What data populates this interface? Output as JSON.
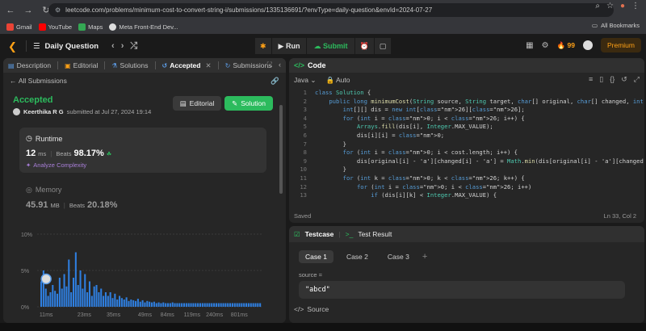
{
  "browser": {
    "url": "leetcode.com/problems/minimum-cost-to-convert-string-i/submissions/1335136691/?envType=daily-question&envId=2024-07-27",
    "bookmarks": [
      {
        "label": "Gmail",
        "color": "#ea4335"
      },
      {
        "label": "YouTube",
        "color": "#ff0000"
      },
      {
        "label": "Maps",
        "color": "#34a853"
      },
      {
        "label": "Meta Front-End Dev...",
        "color": "#dddddd"
      }
    ],
    "all_bookmarks": "All Bookmarks"
  },
  "topbar": {
    "title": "Daily Question",
    "run": "Run",
    "submit": "Submit",
    "streak": "99",
    "premium": "Premium"
  },
  "left_tabs": [
    {
      "label": "Description",
      "icon": "description-icon",
      "active": false
    },
    {
      "label": "Editorial",
      "icon": "editorial-icon",
      "active": false
    },
    {
      "label": "Solutions",
      "icon": "solutions-icon",
      "active": false
    },
    {
      "label": "Accepted",
      "icon": "history-icon",
      "active": true
    },
    {
      "label": "Submissions",
      "icon": "submissions-icon",
      "active": false
    }
  ],
  "submission": {
    "back": "All Submissions",
    "status": "Accepted",
    "author": "Keerthika R G",
    "submitted": "submitted at Jul 27, 2024 19:14",
    "editorial_btn": "Editorial",
    "solution_btn": "Solution",
    "runtime_label": "Runtime",
    "runtime_value": "12",
    "runtime_unit": "ms",
    "beats_label": "Beats",
    "runtime_beats": "98.17%",
    "analyze": "Analyze Complexity",
    "memory_label": "Memory",
    "memory_value": "45.91",
    "memory_unit": "MB",
    "memory_beats": "20.18%"
  },
  "chart_data": {
    "type": "bar",
    "y_ticks": [
      "10%",
      "5%",
      "0%"
    ],
    "ylim": [
      0,
      10
    ],
    "x_ticks": [
      "11ms",
      "23ms",
      "35ms",
      "49ms",
      "84ms",
      "119ms",
      "240ms",
      "801ms"
    ],
    "highlight_index": 2,
    "values": [
      3.5,
      5,
      2.5,
      1.5,
      2,
      3,
      2.2,
      1.8,
      4,
      2.5,
      4.5,
      2.8,
      6.5,
      2,
      4,
      7.5,
      3,
      5,
      2.5,
      4.5,
      2,
      3.5,
      1.5,
      2.8,
      3,
      2,
      2.5,
      1.5,
      2,
      1.5,
      2,
      1.2,
      1.8,
      1,
      1.5,
      1.2,
      1,
      1.3,
      0.8,
      1,
      0.9,
      0.8,
      1.1,
      0.7,
      0.9,
      0.6,
      0.8,
      0.7,
      0.6,
      0.7,
      0.5,
      0.6,
      0.5,
      0.6,
      0.5,
      0.5,
      0.5,
      0.6,
      0.5,
      0.5,
      0.5,
      0.5,
      0.5,
      0.5,
      0.5,
      0.5,
      0.5,
      0.5,
      0.5,
      0.5,
      0.5,
      0.5,
      0.5,
      0.5,
      0.5,
      0.5,
      0.5,
      0.5,
      0.5,
      0.5,
      0.5,
      0.5,
      0.5,
      0.5,
      0.5,
      0.5,
      0.5,
      0.5,
      0.5,
      0.5,
      0.5,
      0.5,
      0.5,
      0.5,
      0.5,
      0.5
    ]
  },
  "code_panel": {
    "title": "Code",
    "lang": "Java",
    "auto": "Auto",
    "saved": "Saved",
    "cursor": "Ln 33, Col 2",
    "lines": [
      "class Solution {",
      "    public long minimumCost(String source, String target, char[] original, char[] changed, int[] co",
      "        int[][] dis = new int[26][26];",
      "        for (int i = 0; i < 26; i++) {",
      "            Arrays.fill(dis[i], Integer.MAX_VALUE);",
      "            dis[i][i] = 0;",
      "        }",
      "        for (int i = 0; i < cost.length; i++) {",
      "            dis[original[i] - 'a'][changed[i] - 'a'] = Math.min(dis[original[i] - 'a'][changed[i] -",
      "        }",
      "        for (int k = 0; k < 26; k++) {",
      "            for (int i = 0; i < 26; i++)",
      "                if (dis[i][k] < Integer.MAX_VALUE) {"
    ]
  },
  "testcase": {
    "tab": "Testcase",
    "result_tab": "Test Result",
    "cases": [
      "Case 1",
      "Case 2",
      "Case 3"
    ],
    "source_label": "source =",
    "source_value": "\"abcd\"",
    "source_section": "Source"
  },
  "colors": {
    "accent": "#2cbb5d",
    "brand": "#ffa116",
    "bar": "#2f7fe0"
  }
}
